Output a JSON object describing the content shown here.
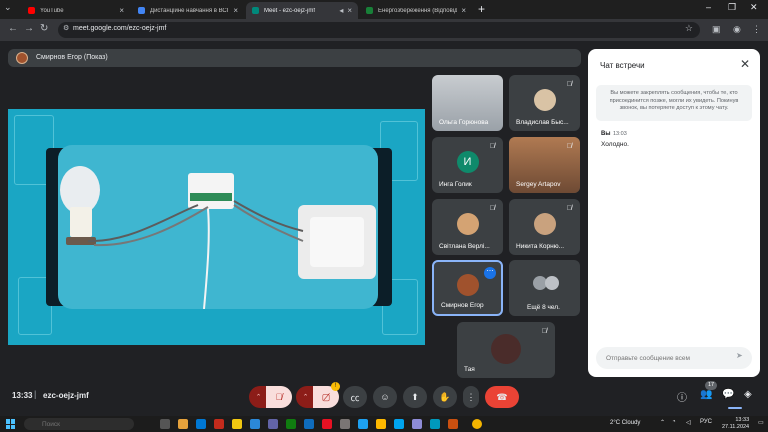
{
  "browser": {
    "tabs": [
      {
        "title": "YouTube",
        "active": false,
        "color": "#ff0000"
      },
      {
        "title": "Дистанційне навчання в ВСП КФК ...",
        "active": false,
        "color": "#4285f4"
      },
      {
        "title": "Meet - ezc-oejz-jmf",
        "active": true,
        "color": "#00897b"
      },
      {
        "title": "Енергозбереження (Відповіді) - Go...",
        "active": false,
        "color": "#188038"
      }
    ],
    "url": "meet.google.com/ezc-oejz-jmf"
  },
  "meet": {
    "presenter_label": "Смирнов Егор (Показ)",
    "participants": [
      {
        "name": "Ольга Горюнова",
        "muted": false
      },
      {
        "name": "Владислав Быс...",
        "muted": true
      },
      {
        "name": "Инга Голик",
        "initial": "И",
        "muted": true
      },
      {
        "name": "Sergey Artapov",
        "muted": true
      },
      {
        "name": "Світлана Верлі...",
        "muted": true
      },
      {
        "name": "Никита Корню...",
        "muted": true
      },
      {
        "name": "Смирнов Егор",
        "muted": false,
        "self": true
      },
      {
        "name": "Ещё 8 чел.",
        "muted": false
      },
      {
        "name": "Тая",
        "muted": true
      }
    ],
    "meeting_time": "13:33",
    "meeting_code": "ezc-oejz-jmf",
    "alert_count": "!",
    "people_count": "17"
  },
  "chat": {
    "title": "Чат встречи",
    "info": "Вы можете закреплять сообщения, чтобы те, кто присоединится позже, могли их увидеть. Покинув звонок, вы потеряете доступ к этому чату.",
    "sender": "Вы",
    "time": "13:03",
    "message": "Холодно.",
    "input_placeholder": "Отправьте сообщение всем"
  },
  "taskbar": {
    "search_placeholder": "Поиск",
    "weather": "2°C  Cloudy",
    "lang": "РУС",
    "time": "13:33",
    "date": "27.11.2024"
  },
  "colors": {
    "accent": "#8ab4f8",
    "end_call": "#ea4335",
    "muted": "#f9dedc"
  }
}
